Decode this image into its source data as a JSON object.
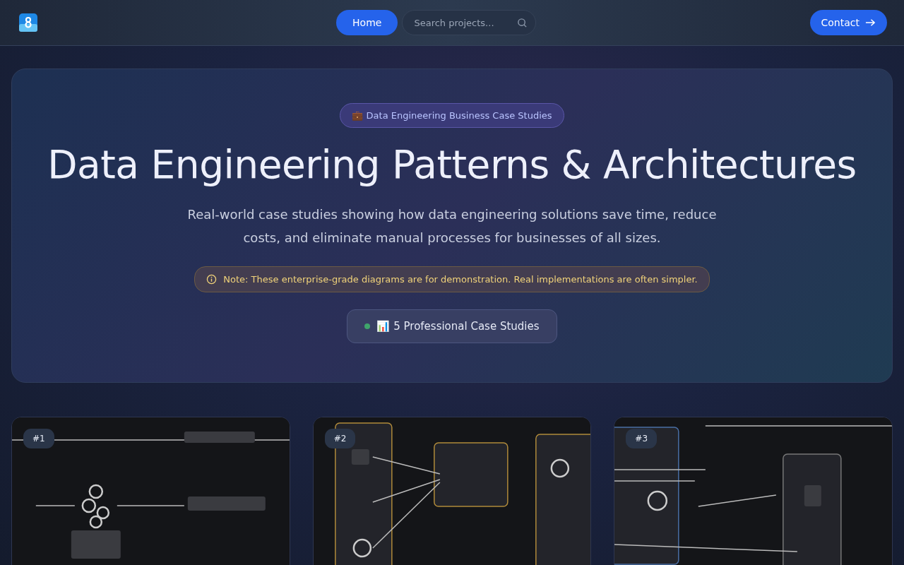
{
  "header": {
    "nav": [
      {
        "label": "Home",
        "selected": true
      }
    ],
    "search": {
      "placeholder": "Search projects..."
    },
    "contact": {
      "label": "Contact"
    }
  },
  "hero": {
    "badge": "💼 Data Engineering Business Case Studies",
    "title": "Data Engineering Patterns & Architectures",
    "subtitle": "Real-world case studies showing how data engineering solutions save time, reduce costs, and eliminate manual processes for businesses of all sizes.",
    "note": "Note: These enterprise-grade diagrams are for demonstration. Real implementations are often simpler.",
    "stat": {
      "label": "📊 5 Professional Case Studies",
      "color": "#3fa56b"
    }
  },
  "cards": [
    {
      "number": "#1",
      "kind": "picture"
    },
    {
      "number": "#2",
      "kind": "picture"
    },
    {
      "number": "#3",
      "kind": "picture"
    }
  ]
}
